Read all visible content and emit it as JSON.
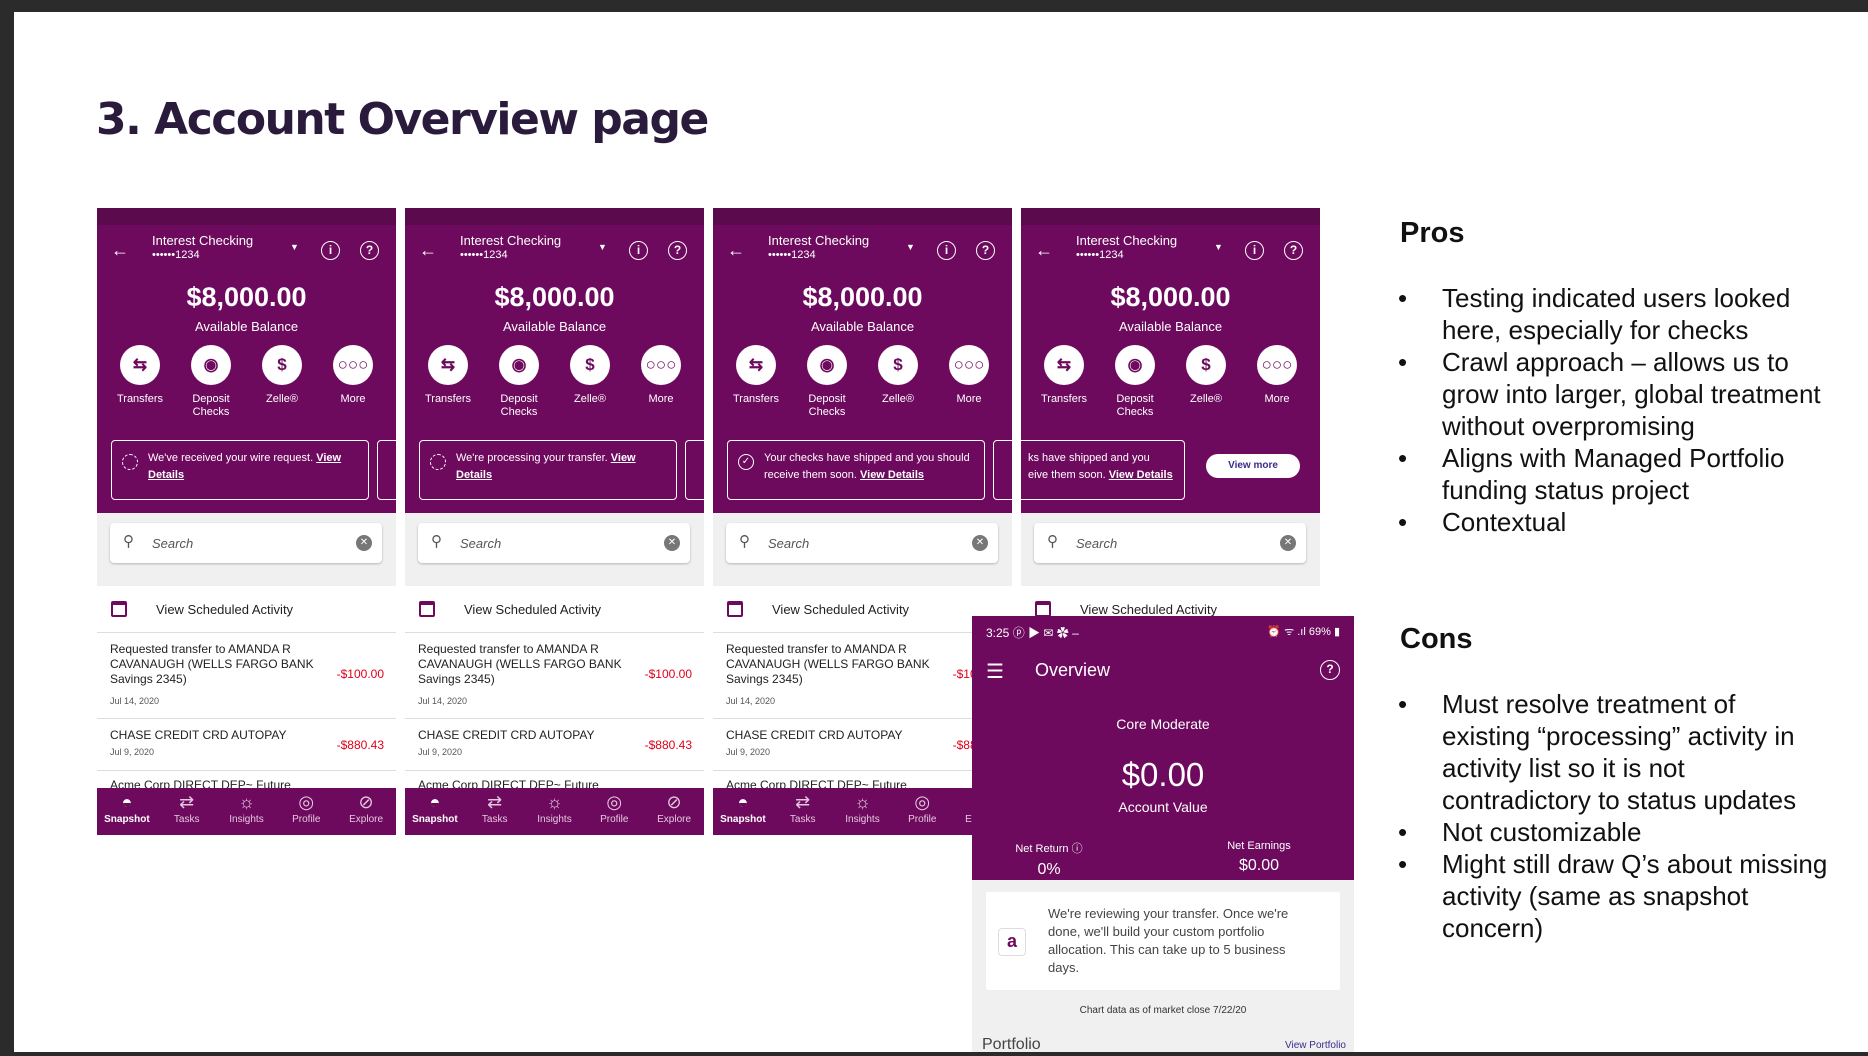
{
  "slide_title": "3. Account Overview page",
  "phone": {
    "account_name": "Interest Checking",
    "account_number": "••••••1234",
    "balance": "$8,000.00",
    "balance_label": "Available Balance",
    "actions": [
      {
        "label": "Transfers",
        "icon": "transfer-icon"
      },
      {
        "label": "Deposit\nChecks",
        "icon": "piggy-bank-icon"
      },
      {
        "label": "Zelle®",
        "icon": "zelle-icon"
      },
      {
        "label": "More",
        "icon": "more-icon"
      }
    ],
    "search_placeholder": "Search",
    "scheduled_label": "View Scheduled Activity",
    "transactions": [
      {
        "desc": "Requested transfer to AMANDA R CAVANAUGH (WELLS FARGO BANK Savings 2345)",
        "date": "Jul 14, 2020",
        "amount": "-$100.00"
      },
      {
        "desc": "CHASE CREDIT CRD AUTOPAY",
        "date": "Jul 9, 2020",
        "amount": "-$880.43"
      },
      {
        "desc": "Acme Corp DIRECT DEP~ Future",
        "date": "",
        "amount": ""
      }
    ],
    "nav": [
      "Snapshot",
      "Tasks",
      "Insights",
      "Profile",
      "Explore"
    ]
  },
  "banners": [
    {
      "text": "We've received your wire request.",
      "link": "View Details"
    },
    {
      "text": "We're processing your transfer.",
      "link": "View Details"
    },
    {
      "text": "Your checks have shipped and you should receive them soon.",
      "link": "View Details"
    },
    {
      "text": "ks have shipped and you\neive them soon.",
      "link": "View Details",
      "button": "View more"
    }
  ],
  "overview": {
    "time": "3:25",
    "status_right": "69%",
    "title": "Overview",
    "portfolio_name": "Core Moderate",
    "value": "$0.00",
    "value_label": "Account Value",
    "net_return_label": "Net Return",
    "net_return": "0%",
    "net_earnings_label": "Net Earnings",
    "net_earnings": "$0.00",
    "message": "We're reviewing your transfer. Once we're done, we'll build your custom portfolio allocation. This can take up to 5 business days.",
    "note": "Chart data as of market close 7/22/20",
    "portfolio_label": "Portfolio",
    "view_portfolio": "View Portfolio"
  },
  "pros": {
    "heading": "Pros",
    "items": [
      "Testing indicated users looked here, especially for checks",
      "Crawl approach – allows us to grow into larger, global treatment without overpromising",
      "Aligns with Managed Portfolio funding status project",
      "Contextual"
    ]
  },
  "cons": {
    "heading": "Cons",
    "items": [
      "Must resolve treatment of existing “processing” activity in activity list so it is not contradictory to status updates",
      "Not customizable",
      "Might still draw Q’s about missing activity (same as snapshot concern)"
    ]
  },
  "colors": {
    "brand_purple": "#6e0a5e",
    "negative": "#e0001b",
    "link": "#3b2b8a"
  }
}
